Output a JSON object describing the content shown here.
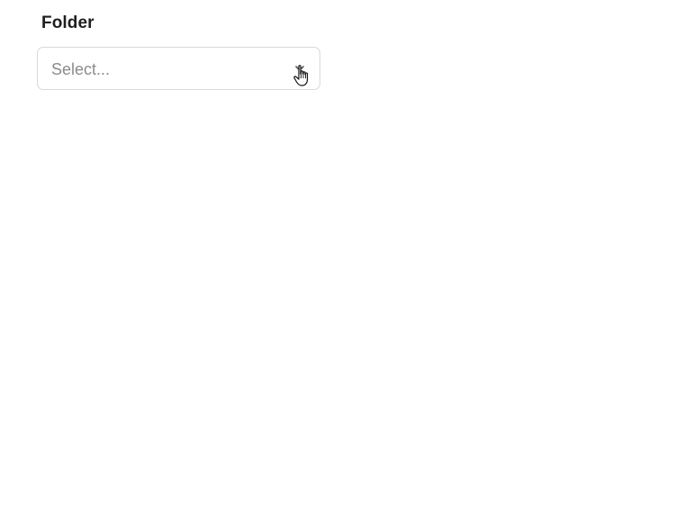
{
  "folder_field": {
    "label": "Folder",
    "placeholder": "Select...",
    "icon": "chevron-down-icon"
  },
  "cursor": {
    "icon": "hand-pointer-cursor-icon"
  }
}
